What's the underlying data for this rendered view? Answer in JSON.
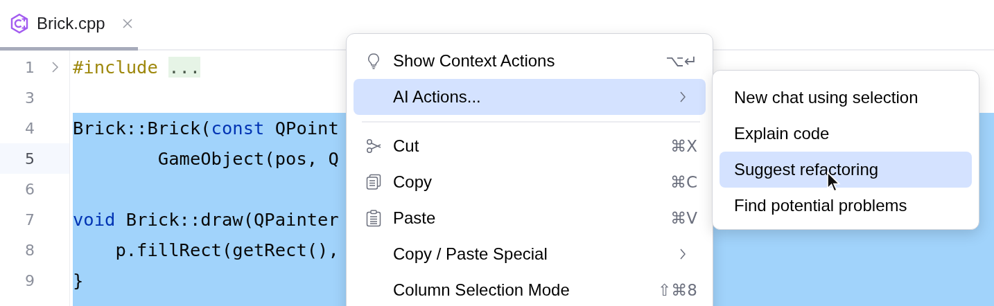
{
  "tab": {
    "label": "Brick.cpp",
    "selected": true
  },
  "editor": {
    "lines": [
      {
        "number": "1",
        "foldable": true,
        "current": false,
        "selected": false,
        "tokens": [
          {
            "text": "#include",
            "kind": "preprocessor"
          },
          {
            "text": "...",
            "kind": "folded"
          }
        ]
      },
      {
        "number": "3",
        "foldable": false,
        "current": false,
        "selected": false
      },
      {
        "number": "4",
        "foldable": false,
        "current": false,
        "selected": true,
        "tokens": [
          {
            "text": "Brick::Brick(",
            "kind": "plain"
          },
          {
            "text": "const",
            "kind": "keyword"
          },
          {
            "text": " QPoint",
            "kind": "plain"
          }
        ]
      },
      {
        "number": "5",
        "foldable": false,
        "current": true,
        "selected": true,
        "tokens": [
          {
            "text": "        GameObject(pos, Q",
            "kind": "plain"
          }
        ]
      },
      {
        "number": "6",
        "foldable": false,
        "current": false,
        "selected": true
      },
      {
        "number": "7",
        "foldable": false,
        "current": false,
        "selected": true,
        "tokens": [
          {
            "text": "void",
            "kind": "keyword"
          },
          {
            "text": " Brick::draw(QPainter",
            "kind": "plain"
          }
        ]
      },
      {
        "number": "8",
        "foldable": false,
        "current": false,
        "selected": true,
        "tokens": [
          {
            "text": "    p.fillRect(getRect(),",
            "kind": "plain"
          }
        ]
      },
      {
        "number": "9",
        "foldable": false,
        "current": false,
        "selected": true,
        "tokens": [
          {
            "text": "}",
            "kind": "plain"
          }
        ]
      }
    ]
  },
  "context_menu": {
    "items": [
      {
        "kind": "bulb",
        "label": "Show Context Actions",
        "shortcut": "⌥↵",
        "selected": false
      },
      {
        "kind": "submenu",
        "label": "AI Actions...",
        "selected": true
      },
      {
        "kind": "separator"
      },
      {
        "kind": "scissors",
        "label": "Cut",
        "shortcut": "⌘X",
        "selected": false
      },
      {
        "kind": "copy",
        "label": "Copy",
        "shortcut": "⌘C",
        "selected": false
      },
      {
        "kind": "clipboard",
        "label": "Paste",
        "shortcut": "⌘V",
        "selected": false
      },
      {
        "kind": "submenu",
        "label": "Copy / Paste Special",
        "selected": false
      },
      {
        "kind": "plain",
        "label": "Column Selection Mode",
        "shortcut": "⇧⌘8",
        "selected": false
      }
    ]
  },
  "submenu": {
    "items": [
      {
        "label": "New chat using selection",
        "selected": false
      },
      {
        "label": "Explain code",
        "selected": false
      },
      {
        "label": "Suggest refactoring",
        "selected": true
      },
      {
        "label": "Find potential problems",
        "selected": false
      }
    ]
  }
}
